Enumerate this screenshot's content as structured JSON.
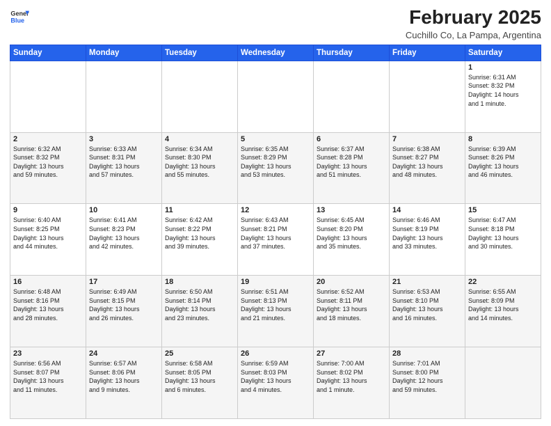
{
  "logo": {
    "general": "General",
    "blue": "Blue"
  },
  "header": {
    "month_year": "February 2025",
    "location": "Cuchillo Co, La Pampa, Argentina"
  },
  "days_of_week": [
    "Sunday",
    "Monday",
    "Tuesday",
    "Wednesday",
    "Thursday",
    "Friday",
    "Saturday"
  ],
  "weeks": [
    [
      {
        "day": "",
        "info": ""
      },
      {
        "day": "",
        "info": ""
      },
      {
        "day": "",
        "info": ""
      },
      {
        "day": "",
        "info": ""
      },
      {
        "day": "",
        "info": ""
      },
      {
        "day": "",
        "info": ""
      },
      {
        "day": "1",
        "info": "Sunrise: 6:31 AM\nSunset: 8:32 PM\nDaylight: 14 hours\nand 1 minute."
      }
    ],
    [
      {
        "day": "2",
        "info": "Sunrise: 6:32 AM\nSunset: 8:32 PM\nDaylight: 13 hours\nand 59 minutes."
      },
      {
        "day": "3",
        "info": "Sunrise: 6:33 AM\nSunset: 8:31 PM\nDaylight: 13 hours\nand 57 minutes."
      },
      {
        "day": "4",
        "info": "Sunrise: 6:34 AM\nSunset: 8:30 PM\nDaylight: 13 hours\nand 55 minutes."
      },
      {
        "day": "5",
        "info": "Sunrise: 6:35 AM\nSunset: 8:29 PM\nDaylight: 13 hours\nand 53 minutes."
      },
      {
        "day": "6",
        "info": "Sunrise: 6:37 AM\nSunset: 8:28 PM\nDaylight: 13 hours\nand 51 minutes."
      },
      {
        "day": "7",
        "info": "Sunrise: 6:38 AM\nSunset: 8:27 PM\nDaylight: 13 hours\nand 48 minutes."
      },
      {
        "day": "8",
        "info": "Sunrise: 6:39 AM\nSunset: 8:26 PM\nDaylight: 13 hours\nand 46 minutes."
      }
    ],
    [
      {
        "day": "9",
        "info": "Sunrise: 6:40 AM\nSunset: 8:25 PM\nDaylight: 13 hours\nand 44 minutes."
      },
      {
        "day": "10",
        "info": "Sunrise: 6:41 AM\nSunset: 8:23 PM\nDaylight: 13 hours\nand 42 minutes."
      },
      {
        "day": "11",
        "info": "Sunrise: 6:42 AM\nSunset: 8:22 PM\nDaylight: 13 hours\nand 39 minutes."
      },
      {
        "day": "12",
        "info": "Sunrise: 6:43 AM\nSunset: 8:21 PM\nDaylight: 13 hours\nand 37 minutes."
      },
      {
        "day": "13",
        "info": "Sunrise: 6:45 AM\nSunset: 8:20 PM\nDaylight: 13 hours\nand 35 minutes."
      },
      {
        "day": "14",
        "info": "Sunrise: 6:46 AM\nSunset: 8:19 PM\nDaylight: 13 hours\nand 33 minutes."
      },
      {
        "day": "15",
        "info": "Sunrise: 6:47 AM\nSunset: 8:18 PM\nDaylight: 13 hours\nand 30 minutes."
      }
    ],
    [
      {
        "day": "16",
        "info": "Sunrise: 6:48 AM\nSunset: 8:16 PM\nDaylight: 13 hours\nand 28 minutes."
      },
      {
        "day": "17",
        "info": "Sunrise: 6:49 AM\nSunset: 8:15 PM\nDaylight: 13 hours\nand 26 minutes."
      },
      {
        "day": "18",
        "info": "Sunrise: 6:50 AM\nSunset: 8:14 PM\nDaylight: 13 hours\nand 23 minutes."
      },
      {
        "day": "19",
        "info": "Sunrise: 6:51 AM\nSunset: 8:13 PM\nDaylight: 13 hours\nand 21 minutes."
      },
      {
        "day": "20",
        "info": "Sunrise: 6:52 AM\nSunset: 8:11 PM\nDaylight: 13 hours\nand 18 minutes."
      },
      {
        "day": "21",
        "info": "Sunrise: 6:53 AM\nSunset: 8:10 PM\nDaylight: 13 hours\nand 16 minutes."
      },
      {
        "day": "22",
        "info": "Sunrise: 6:55 AM\nSunset: 8:09 PM\nDaylight: 13 hours\nand 14 minutes."
      }
    ],
    [
      {
        "day": "23",
        "info": "Sunrise: 6:56 AM\nSunset: 8:07 PM\nDaylight: 13 hours\nand 11 minutes."
      },
      {
        "day": "24",
        "info": "Sunrise: 6:57 AM\nSunset: 8:06 PM\nDaylight: 13 hours\nand 9 minutes."
      },
      {
        "day": "25",
        "info": "Sunrise: 6:58 AM\nSunset: 8:05 PM\nDaylight: 13 hours\nand 6 minutes."
      },
      {
        "day": "26",
        "info": "Sunrise: 6:59 AM\nSunset: 8:03 PM\nDaylight: 13 hours\nand 4 minutes."
      },
      {
        "day": "27",
        "info": "Sunrise: 7:00 AM\nSunset: 8:02 PM\nDaylight: 13 hours\nand 1 minute."
      },
      {
        "day": "28",
        "info": "Sunrise: 7:01 AM\nSunset: 8:00 PM\nDaylight: 12 hours\nand 59 minutes."
      },
      {
        "day": "",
        "info": ""
      }
    ]
  ]
}
